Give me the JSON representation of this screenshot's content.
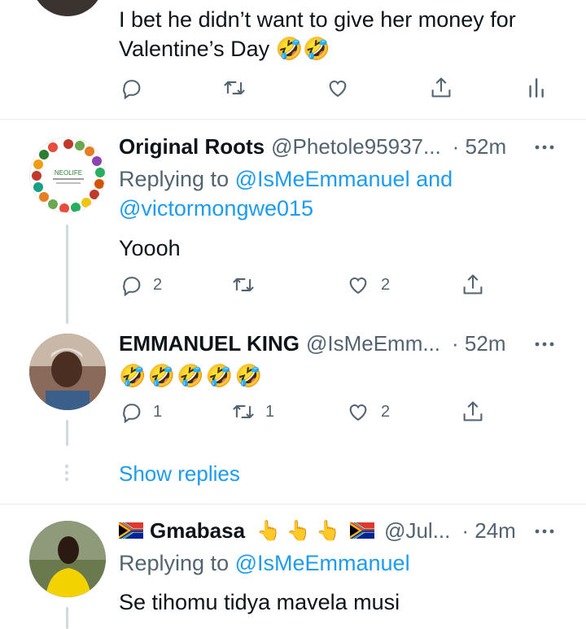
{
  "tweet1": {
    "text_line1": "I bet he didn’t want to give her money for",
    "text_line2": "Valentine’s Day",
    "emoji": "🤣🤣"
  },
  "tweet2": {
    "name": "Original Roots",
    "handle": "@Phetole95937...",
    "time": "· 52m",
    "replying_prefix": "Replying to ",
    "reply_user1": "@IsMeEmmanuel",
    "reply_and": " and",
    "reply_user2": "@victormongwe015",
    "text": "Yoooh",
    "reply_count": "2",
    "like_count": "2",
    "avatar_brand": "NEOLIFE"
  },
  "tweet3": {
    "name": "EMMANUEL KING",
    "handle": "@IsMeEmm...",
    "time": "· 52m",
    "emoji": "🤣🤣🤣🤣🤣",
    "reply_count": "1",
    "retweet_count": "1",
    "like_count": "2"
  },
  "show_replies": "Show replies",
  "tweet4": {
    "name": "Gmabasa",
    "name_emoji": "👆 👆 👆",
    "handle": "@Jul...",
    "time": "· 24m",
    "replying_prefix": "Replying to ",
    "reply_user1": "@IsMeEmmanuel",
    "text": "Se tihomu tidya mavela musi"
  },
  "colors": {
    "accent": "#1d9bf0",
    "icon": "#536471",
    "thread_line": "#cfd9de",
    "divider": "#e6ecf0"
  }
}
